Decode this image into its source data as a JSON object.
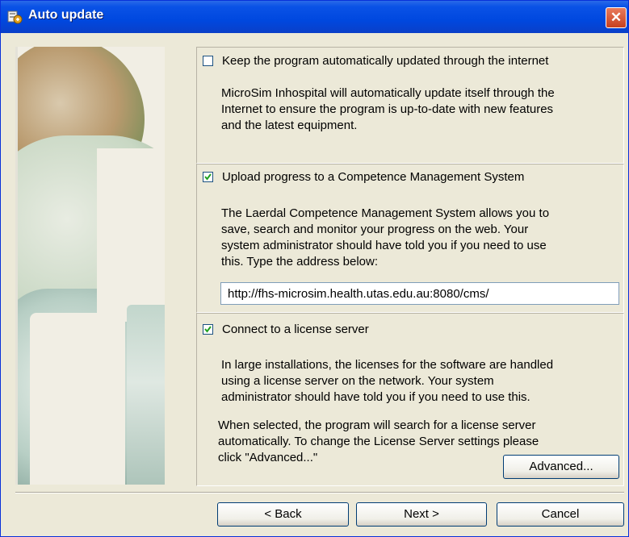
{
  "window": {
    "title": "Auto update",
    "close_label": "✕"
  },
  "options": {
    "auto_update": {
      "checked": false,
      "label": "Keep the program automatically updated through the internet",
      "description_lines": [
        "MicroSim Inhospital will automatically update itself through the",
        "Internet to ensure the program is up-to-date with new features",
        "and the latest equipment."
      ]
    },
    "upload_progress": {
      "checked": true,
      "label": "Upload progress to a Competence Management System",
      "description_lines": [
        "The Laerdal Competence Management System allows you to",
        "save, search and monitor your progress on the web. Your",
        "system administrator should have told you if you need to use",
        "this. Type the address below:"
      ],
      "url_value": "http://fhs-microsim.health.utas.edu.au:8080/cms/"
    },
    "license_server": {
      "checked": true,
      "label": "Connect to a license server",
      "description_lines": [
        "In large installations, the licenses for the software are handled",
        "using a license server on the network. Your system",
        "administrator should have told you if you need to use this."
      ],
      "note_lines": [
        "When selected, the program will search for a license server",
        "automatically. To change the License Server settings please",
        "click \"Advanced...\""
      ],
      "advanced_label": "Advanced..."
    }
  },
  "buttons": {
    "back": "< Back",
    "next": "Next >",
    "cancel": "Cancel"
  },
  "colors": {
    "titlebar": "#0a52e6",
    "close": "#d8552f",
    "dialog_bg": "#ece9d8",
    "check": "#21a121"
  }
}
